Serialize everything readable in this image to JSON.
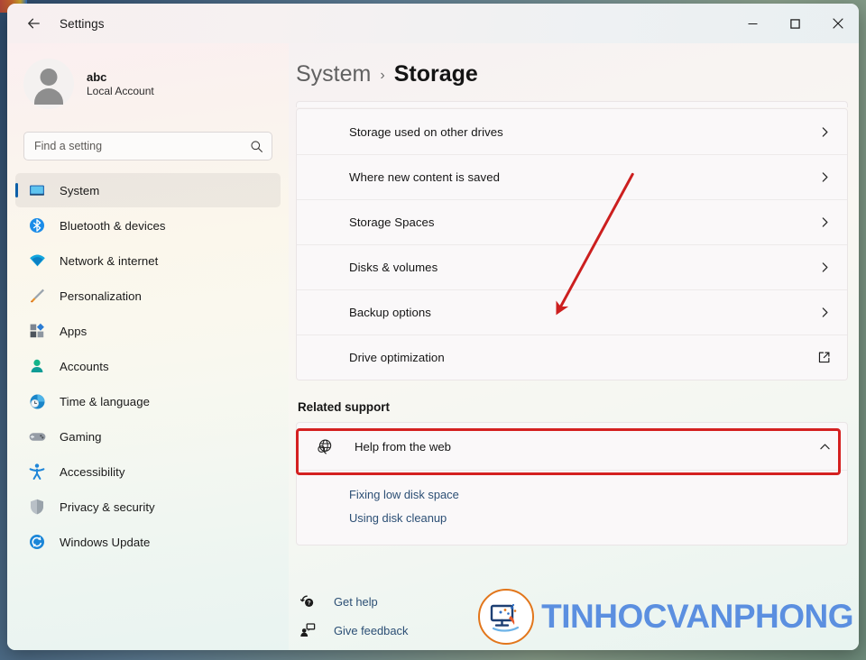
{
  "window": {
    "title": "Settings",
    "back_icon": "back-arrow-icon",
    "controls": {
      "minimize": "minimize-icon",
      "maximize": "maximize-icon",
      "close": "close-icon"
    }
  },
  "sidebar": {
    "account": {
      "name": "abc",
      "type": "Local Account",
      "avatar_icon": "person-avatar-icon"
    },
    "search": {
      "placeholder": "Find a setting",
      "value": "",
      "icon": "search-icon"
    },
    "items": [
      {
        "label": "System",
        "icon": "monitor-icon",
        "active": true
      },
      {
        "label": "Bluetooth & devices",
        "icon": "bluetooth-icon",
        "active": false
      },
      {
        "label": "Network & internet",
        "icon": "wifi-icon",
        "active": false
      },
      {
        "label": "Personalization",
        "icon": "paintbrush-icon",
        "active": false
      },
      {
        "label": "Apps",
        "icon": "apps-grid-icon",
        "active": false
      },
      {
        "label": "Accounts",
        "icon": "account-person-icon",
        "active": false
      },
      {
        "label": "Time & language",
        "icon": "clock-globe-icon",
        "active": false
      },
      {
        "label": "Gaming",
        "icon": "gamepad-icon",
        "active": false
      },
      {
        "label": "Accessibility",
        "icon": "accessibility-icon",
        "active": false
      },
      {
        "label": "Privacy & security",
        "icon": "shield-icon",
        "active": false
      },
      {
        "label": "Windows Update",
        "icon": "update-refresh-icon",
        "active": false
      }
    ]
  },
  "main": {
    "breadcrumb": {
      "parent": "System",
      "separator": "›",
      "current": "Storage"
    },
    "settings_rows": [
      {
        "label": "Storage used on other drives",
        "trailing_icon": "chevron-right-icon",
        "highlighted": false
      },
      {
        "label": "Where new content is saved",
        "trailing_icon": "chevron-right-icon",
        "highlighted": false
      },
      {
        "label": "Storage Spaces",
        "trailing_icon": "chevron-right-icon",
        "highlighted": false
      },
      {
        "label": "Disks & volumes",
        "trailing_icon": "chevron-right-icon",
        "highlighted": false
      },
      {
        "label": "Backup options",
        "trailing_icon": "chevron-right-icon",
        "highlighted": false
      },
      {
        "label": "Drive optimization",
        "trailing_icon": "open-external-icon",
        "highlighted": true
      }
    ],
    "related_support": {
      "heading": "Related support",
      "help_from_web": {
        "label": "Help from the web",
        "icon": "globe-search-icon",
        "expand_icon": "chevron-up-icon",
        "expanded": true,
        "links": [
          "Fixing low disk space",
          "Using disk cleanup"
        ]
      }
    },
    "footer": [
      {
        "label": "Get help",
        "icon": "help-question-icon"
      },
      {
        "label": "Give feedback",
        "icon": "feedback-person-icon"
      }
    ]
  },
  "annotations": {
    "highlight_color": "#d42020",
    "arrow_color": "#cc1f1f",
    "target_row": "Drive optimization"
  },
  "watermark": {
    "text": "TINHOCVANPHONG",
    "badge_icon": "monitor-logo-icon",
    "text_color": "#5b8fe0",
    "ring_color": "#e2761b"
  }
}
